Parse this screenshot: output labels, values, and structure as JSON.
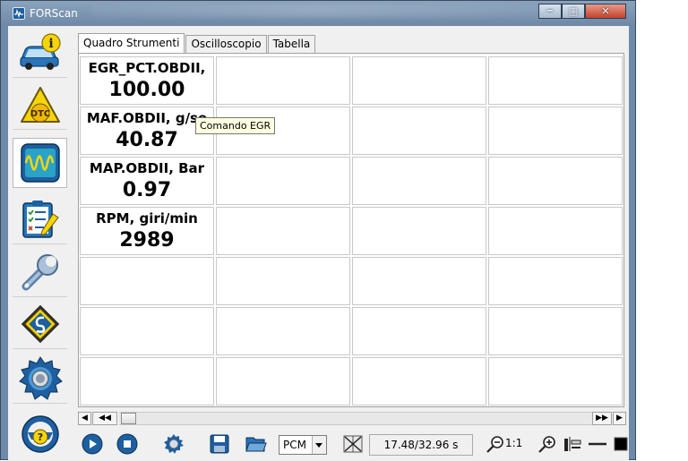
{
  "window": {
    "title": "FORScan",
    "minimize_glyph": "‒",
    "maximize_glyph": "□",
    "close_glyph": "✕"
  },
  "sidebar": {
    "items": [
      {
        "icon": "vehicle-info-icon"
      },
      {
        "icon": "dtc-icon",
        "label": "DTC"
      },
      {
        "icon": "oscilloscope-icon"
      },
      {
        "icon": "checklist-icon"
      },
      {
        "icon": "wrench-icon"
      },
      {
        "icon": "module-programming-icon"
      },
      {
        "icon": "settings-gear-icon"
      },
      {
        "icon": "help-steering-wheel-icon"
      }
    ]
  },
  "tabs": [
    {
      "label": "Quadro Strumenti",
      "active": true
    },
    {
      "label": "Oscilloscopio",
      "active": false
    },
    {
      "label": "Tabella",
      "active": false
    }
  ],
  "gauges": [
    {
      "label": "EGR_PCT.OBDII,",
      "value": "100.00"
    },
    {
      "label": "MAF.OBDII, g/se",
      "value": "40.87"
    },
    {
      "label": "MAP.OBDII, Bar",
      "value": "0.97"
    },
    {
      "label": "RPM, giri/min",
      "value": "2989"
    }
  ],
  "tooltip": "Comando EGR",
  "toolbar": {
    "module_select": "PCM",
    "time_readout": "17.48/32.96 s",
    "zoom_ratio": "1:1"
  },
  "colors": {
    "titlebar": "#7990ab",
    "accent_blue": "#1d5fa0",
    "close_red": "#c5422d",
    "tooltip_bg": "#ffffe1"
  }
}
